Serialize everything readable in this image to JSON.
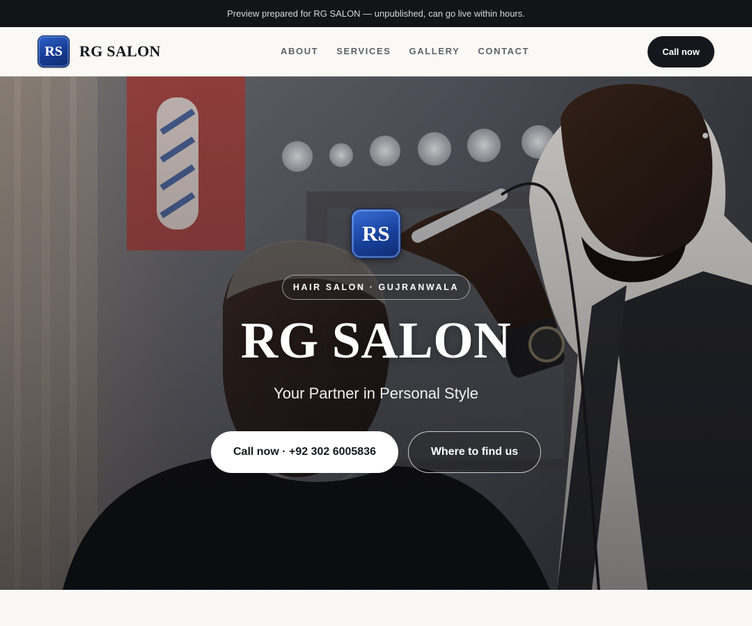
{
  "preview_banner": {
    "text": "Preview prepared for RG SALON — unpublished, can go live within hours."
  },
  "header": {
    "logo_text": "RS",
    "brand_name": "RG SALON",
    "nav": [
      {
        "label": "ABOUT"
      },
      {
        "label": "SERVICES"
      },
      {
        "label": "GALLERY"
      },
      {
        "label": "CONTACT"
      }
    ],
    "cta_label": "Call now"
  },
  "hero": {
    "logo_text": "RS",
    "tag": "HAIR SALON · GUJRANWALA",
    "title": "RG SALON",
    "subtitle": "Your Partner in Personal Style",
    "primary_button": "Call now · +92 302 6005836",
    "secondary_button": "Where to find us",
    "image_description_icon": "barber-photo"
  },
  "colors": {
    "topbar_bg": "#121418",
    "nav_cta_bg": "#15171c",
    "logo_blue": "#18419c",
    "page_bg": "#f9f8f5"
  }
}
